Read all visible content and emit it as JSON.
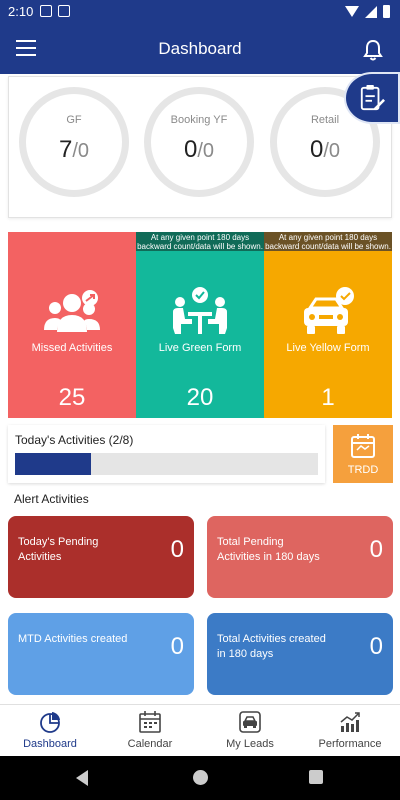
{
  "status_bar": {
    "time": "2:10"
  },
  "app_bar": {
    "title": "Dashboard"
  },
  "scores": [
    {
      "label": "GF",
      "value": "7",
      "total": "/0"
    },
    {
      "label": "Booking YF",
      "value": "0",
      "total": "/0"
    },
    {
      "label": "Retail",
      "value": "0",
      "total": "/0"
    }
  ],
  "tiles": [
    {
      "label": "Missed Activities",
      "count": "25",
      "note": "",
      "color": "#f36262"
    },
    {
      "label": "Live Green Form",
      "count": "20",
      "note": "At any given point 180 days backward count/data will be shown.",
      "color": "#13b89b"
    },
    {
      "label": "Live Yellow Form",
      "count": "1",
      "note": "At any given point 180 days backward count/data will be shown.",
      "color": "#f6a800"
    }
  ],
  "today": {
    "title": "Today's Activities (2/8)",
    "progress": 0.25
  },
  "trdd_label": "TRDD",
  "alert_title": "Alert Activities",
  "alerts": [
    {
      "label": "Today's Pending Activities",
      "value": "0",
      "color": "#ab2f2b"
    },
    {
      "label": "Total Pending Activities in 180 days",
      "value": "0",
      "color": "#de6560"
    },
    {
      "label": "MTD Activities created",
      "value": "0",
      "color": "#5fa0e6"
    },
    {
      "label": "Total Activities created in 180 days",
      "value": "0",
      "color": "#3c7bc6"
    }
  ],
  "nav": [
    {
      "label": "Dashboard",
      "icon": "dashboard-icon",
      "active": true
    },
    {
      "label": "Calendar",
      "icon": "calendar-icon",
      "active": false
    },
    {
      "label": "My Leads",
      "icon": "car-icon",
      "active": false
    },
    {
      "label": "Performance",
      "icon": "performance-icon",
      "active": false
    }
  ]
}
